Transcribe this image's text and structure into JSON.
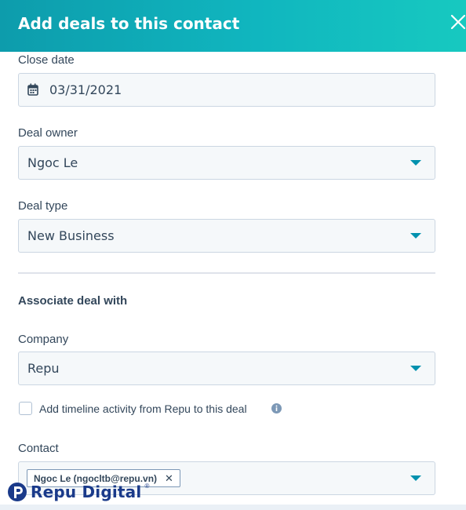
{
  "header": {
    "title": "Add deals to this contact",
    "close_icon": "close-icon"
  },
  "close_date": {
    "label": "Close date",
    "value": "03/31/2021",
    "icon": "calendar-icon"
  },
  "deal_owner": {
    "label": "Deal owner",
    "value": "Ngoc Le"
  },
  "deal_type": {
    "label": "Deal type",
    "value": "New Business"
  },
  "associate": {
    "heading": "Associate deal with"
  },
  "company": {
    "label": "Company",
    "value": "Repu"
  },
  "timeline_checkbox": {
    "label": "Add timeline activity from Repu to this deal",
    "checked": false
  },
  "contact": {
    "label": "Contact",
    "tags": [
      {
        "label": "Ngoc Le (ngocltb@repu.vn)",
        "remove": "✕"
      }
    ]
  },
  "watermark": {
    "text": "Repu Digital",
    "mark": "®"
  },
  "colors": {
    "header_start": "#0d9cac",
    "header_end": "#17c9c0",
    "accent": "#0091ae",
    "text": "#33475b",
    "field_bg": "#f5f8fa",
    "field_border": "#cbd6e2",
    "watermark": "#1a3a8a"
  }
}
